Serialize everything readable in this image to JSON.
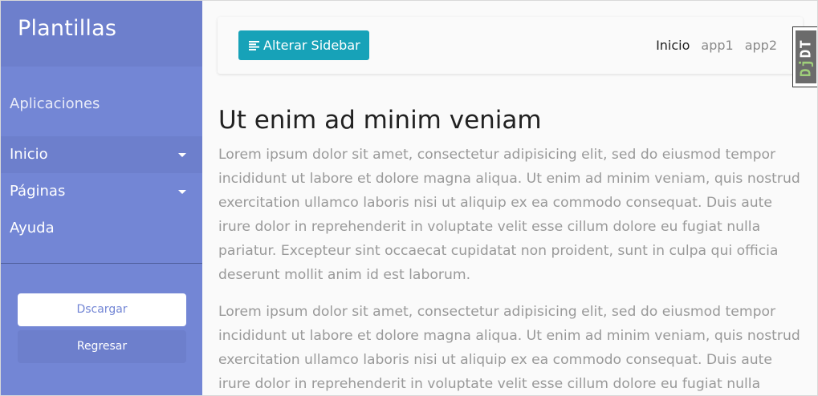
{
  "sidebar": {
    "title": "Plantillas",
    "subtitle": "Aplicaciones",
    "items": [
      {
        "label": "Inicio",
        "has_submenu": true,
        "active": true
      },
      {
        "label": "Páginas",
        "has_submenu": true,
        "active": false
      },
      {
        "label": "Ayuda",
        "has_submenu": false,
        "active": false
      }
    ],
    "download_label": "Dscargar",
    "back_label": "Regresar"
  },
  "navbar": {
    "toggle_label": "Alterar Sidebar",
    "links": [
      "Inicio",
      "app1",
      "app2"
    ]
  },
  "main": {
    "heading": "Ut enim ad minim veniam",
    "paragraphs": [
      "Lorem ipsum dolor sit amet, consectetur adipisicing elit, sed do eiusmod tempor incididunt ut labore et dolore magna aliqua. Ut enim ad minim veniam, quis nostrud exercitation ullamco laboris nisi ut aliquip ex ea commodo consequat. Duis aute irure dolor in reprehenderit in voluptate velit esse cillum dolore eu fugiat nulla pariatur. Excepteur sint occaecat cupidatat non proident, sunt in culpa qui officia deserunt mollit anim id est laborum.",
      "Lorem ipsum dolor sit amet, consectetur adipisicing elit, sed do eiusmod tempor incididunt ut labore et dolore magna aliqua. Ut enim ad minim veniam, quis nostrud exercitation ullamco laboris nisi ut aliquip ex ea commodo consequat. Duis aute irure dolor in reprehenderit in voluptate velit esse cillum dolore eu fugiat nulla"
    ]
  },
  "debug_toolbar": {
    "prefix": "Dj",
    "suffix": "DT"
  },
  "colors": {
    "sidebar": "#7386d5",
    "sidebar_dark": "#6d7fcc",
    "toggle_button": "#17a2b8",
    "text_muted": "#999999"
  },
  "icons": {
    "toggle": "align-left-icon",
    "submenu": "caret-down-icon"
  }
}
